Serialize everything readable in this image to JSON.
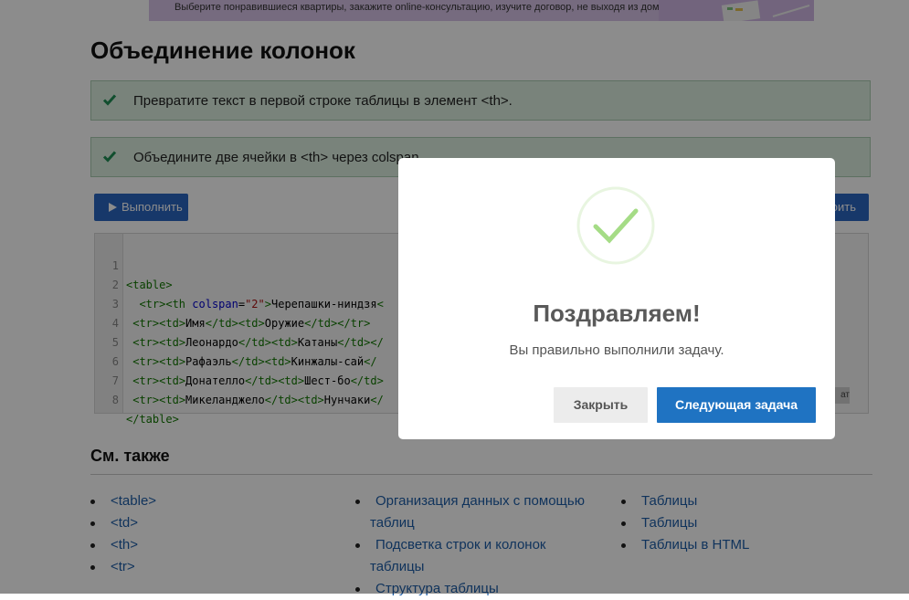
{
  "banner": {
    "text": "Выберите понравившиеся квартиры, закажите online-консультацию, изучите договор, не выходя из дома",
    "bg_color": "#d7c3e8"
  },
  "page": {
    "title": "Объединение колонок"
  },
  "tasks": [
    {
      "text": "Превратите текст в первой строке таблицы в элемент <th>.",
      "icon": "check-icon",
      "status": "done"
    },
    {
      "text": "Объедините две ячейки в <th> через colspan.",
      "icon": "check-icon",
      "status": "done"
    }
  ],
  "toolbar": {
    "run_label": "Выполнить",
    "right_label": "оить",
    "accent_color": "#2b66c2"
  },
  "editor": {
    "line_numbers": [
      "1",
      "2",
      "3",
      "4",
      "5",
      "6",
      "7",
      "8"
    ],
    "result_label": "ат",
    "lines": {
      "l1": {
        "o": "<table>"
      },
      "l2": {
        "indent": "  ",
        "o1": "<tr>",
        "o2": "<th ",
        "attr": "colspan",
        "eq": "=",
        "str": "\"2\"",
        "gt": ">",
        "text": "Черепашки-ниндзя",
        "tail": "<"
      },
      "l3": {
        "indent": " ",
        "o1": "<tr>",
        "o2": "<td>",
        "t1": "Имя",
        "c1": "</td>",
        "o3": "<td>",
        "t2": "Оружие",
        "c2": "</td>",
        "c3": "</tr>"
      },
      "l4": {
        "indent": " ",
        "o1": "<tr>",
        "o2": "<td>",
        "t1": "Леонардо",
        "c1": "</td>",
        "o3": "<td>",
        "t2": "Катаны",
        "c2": "</td>",
        "tail": "</"
      },
      "l5": {
        "indent": " ",
        "o1": "<tr>",
        "o2": "<td>",
        "t1": "Рафаэль",
        "c1": "</td>",
        "o3": "<td>",
        "t2": "Кинжалы-сай",
        "c2": "</"
      },
      "l6": {
        "indent": " ",
        "o1": "<tr>",
        "o2": "<td>",
        "t1": "Донателло",
        "c1": "</td>",
        "o3": "<td>",
        "t2": "Шест-бо",
        "c2": "</td>"
      },
      "l7": {
        "indent": " ",
        "o1": "<tr>",
        "o2": "<td>",
        "t1": "Микеланджело",
        "c1": "</td>",
        "o3": "<td>",
        "t2": "Нунчаки",
        "c2": "</"
      },
      "l8": {
        "o": "</table>"
      }
    }
  },
  "see_also": {
    "title": "См. также",
    "col1": [
      "<table>",
      "<td>",
      "<th>",
      "<tr>"
    ],
    "col2": [
      "Организация данных с помощью таблиц",
      "Подсветка строк и колонок таблицы",
      "Структура таблицы"
    ],
    "col3": [
      "Таблицы",
      "Таблицы",
      "Таблицы в HTML"
    ],
    "link_color": "#1e5ea8"
  },
  "modal": {
    "title": "Поздравляем!",
    "text": "Вы правильно выполнили задачу.",
    "close_label": "Закрыть",
    "next_label": "Следующая задача",
    "icon": "success-check-icon",
    "success_color": "#a5dc86",
    "next_color": "#1f73c2"
  }
}
